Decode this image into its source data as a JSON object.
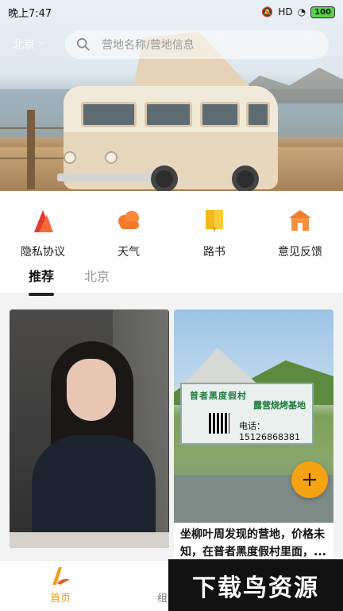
{
  "status_bar": {
    "time": "晚上7:47",
    "battery": "100",
    "signal_label": "HD"
  },
  "header": {
    "city": "北京",
    "search_placeholder": "营地名称/营地信息"
  },
  "quick_menu": [
    {
      "label": "隐私协议",
      "icon": "privacy-icon",
      "color": "#e23b2e"
    },
    {
      "label": "天气",
      "icon": "weather-cloud-icon",
      "color": "#f5792a"
    },
    {
      "label": "路书",
      "icon": "roadbook-icon",
      "color": "#f2b81c"
    },
    {
      "label": "意见反馈",
      "icon": "feedback-icon",
      "color": "#f37a2a"
    }
  ],
  "tabs": [
    {
      "label": "推荐",
      "active": true
    },
    {
      "label": "北京",
      "active": false
    }
  ],
  "cards": [
    {
      "image": "woman-portrait"
    },
    {
      "image": "campsite-banner",
      "banner_line1": "普者黑度假村",
      "banner_line2": "露营烧烤基地",
      "banner_phone": "电话：15126868381",
      "text": "坐柳叶周发现的营地，价格未知，在普者黑度假村里面，..."
    }
  ],
  "fab": {
    "label": "+"
  },
  "bottom_nav": {
    "home_label": "首页",
    "second_label": "组"
  },
  "watermark": "下载鸟资源",
  "colors": {
    "accent": "#f5a213",
    "home_active": "#f39a1c"
  }
}
